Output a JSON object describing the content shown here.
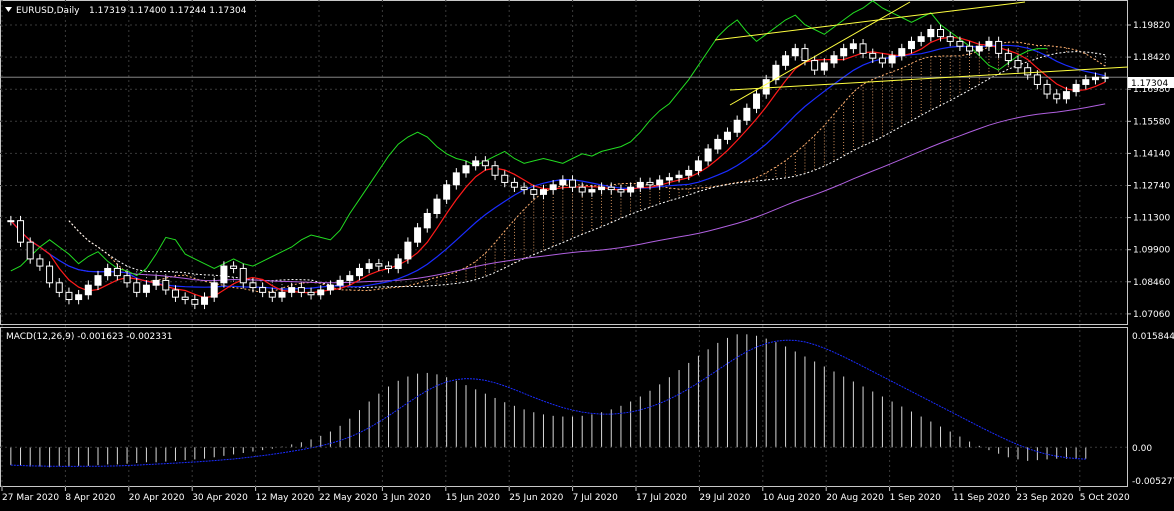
{
  "header": {
    "symbol": "EURUSD,Daily",
    "ohlc": "1.17319 1.17400 1.17244 1.17304",
    "arrow_icon": "triangle-down-icon"
  },
  "macd": {
    "label": "MACD(12,26,9) -0.001623 -0.002331",
    "scale_top": "0.015844",
    "scale_zero": "0.00",
    "scale_bottom": "-0.005277"
  },
  "price_axis": {
    "labels": [
      "1.19820",
      "1.18420",
      "1.16980",
      "1.15580",
      "1.14140",
      "1.12740",
      "1.11300",
      "1.09900",
      "1.08460",
      "1.07060"
    ],
    "current_price": "1.17304"
  },
  "time_axis": {
    "labels": [
      "27 Mar 2020",
      "8 Apr 2020",
      "20 Apr 2020",
      "30 Apr 2020",
      "12 May 2020",
      "22 May 2020",
      "3 Jun 2020",
      "15 Jun 2020",
      "25 Jun 2020",
      "7 Jul 2020",
      "17 Jul 2020",
      "29 Jul 2020",
      "10 Aug 2020",
      "20 Aug 2020",
      "1 Sep 2020",
      "11 Sep 2020",
      "23 Sep 2020",
      "5 Oct 2020"
    ]
  },
  "colors": {
    "background": "#000000",
    "grid": "#3a3a3a",
    "candle": "#ffffff",
    "tenkan": "#ff1a1a",
    "kijun": "#1a2cff",
    "chikou": "#22dd22",
    "senkou_a": "#ffb070",
    "senkou_b": "#ffffff",
    "sma": "#b060e0",
    "trendline": "#ffff40",
    "macd_hist": "#d8d8d8",
    "macd_signal": "#1a2cff"
  },
  "chart_data": {
    "type": "candlestick",
    "symbol": "EURUSD",
    "timeframe": "Daily",
    "ylim": [
      1.0706,
      1.2045
    ],
    "close_series": [
      1.113,
      1.104,
      1.097,
      1.094,
      1.087,
      1.083,
      1.08,
      1.082,
      1.086,
      1.09,
      1.093,
      1.09,
      1.087,
      1.083,
      1.086,
      1.088,
      1.084,
      1.081,
      1.08,
      1.078,
      1.081,
      1.087,
      1.094,
      1.093,
      1.087,
      1.085,
      1.083,
      1.081,
      1.083,
      1.085,
      1.083,
      1.082,
      1.084,
      1.086,
      1.088,
      1.09,
      1.093,
      1.095,
      1.094,
      1.093,
      1.097,
      1.104,
      1.11,
      1.116,
      1.122,
      1.128,
      1.133,
      1.136,
      1.138,
      1.136,
      1.132,
      1.129,
      1.127,
      1.126,
      1.124,
      1.126,
      1.128,
      1.13,
      1.127,
      1.125,
      1.126,
      1.127,
      1.126,
      1.125,
      1.127,
      1.129,
      1.128,
      1.13,
      1.131,
      1.132,
      1.134,
      1.138,
      1.143,
      1.147,
      1.15,
      1.155,
      1.16,
      1.166,
      1.172,
      1.178,
      1.182,
      1.185,
      1.18,
      1.176,
      1.179,
      1.182,
      1.185,
      1.187,
      1.183,
      1.181,
      1.179,
      1.182,
      1.185,
      1.188,
      1.19,
      1.193,
      1.19,
      1.188,
      1.186,
      1.184,
      1.186,
      1.188,
      1.183,
      1.18,
      1.177,
      1.174,
      1.17,
      1.166,
      1.164,
      1.167,
      1.17,
      1.172,
      1.173,
      1.173
    ],
    "macd_hist": [
      -0.0025,
      -0.0026,
      -0.0027,
      -0.0027,
      -0.0028,
      -0.0027,
      -0.0027,
      -0.0026,
      -0.0026,
      -0.0025,
      -0.0024,
      -0.0024,
      -0.0023,
      -0.0022,
      -0.0021,
      -0.0021,
      -0.002,
      -0.0019,
      -0.0018,
      -0.0017,
      -0.0016,
      -0.0014,
      -0.0012,
      -0.001,
      -0.0008,
      -0.0006,
      -0.0004,
      -0.0002,
      0.0001,
      0.0004,
      0.0007,
      0.0011,
      0.0016,
      0.0022,
      0.003,
      0.004,
      0.0052,
      0.0064,
      0.0075,
      0.0085,
      0.0093,
      0.0099,
      0.0103,
      0.0104,
      0.0102,
      0.0098,
      0.0093,
      0.0087,
      0.0081,
      0.0075,
      0.0069,
      0.0063,
      0.0058,
      0.0053,
      0.0049,
      0.0046,
      0.0044,
      0.0043,
      0.0043,
      0.0044,
      0.0046,
      0.0049,
      0.0053,
      0.0058,
      0.0064,
      0.0071,
      0.0079,
      0.0088,
      0.0098,
      0.0108,
      0.0118,
      0.0128,
      0.0137,
      0.0146,
      0.0153,
      0.0158,
      0.0158,
      0.0156,
      0.0152,
      0.0147,
      0.0141,
      0.0134,
      0.0127,
      0.012,
      0.0113,
      0.0106,
      0.0099,
      0.0092,
      0.0085,
      0.0078,
      0.0071,
      0.0064,
      0.0057,
      0.005,
      0.0043,
      0.0036,
      0.0029,
      0.0022,
      0.0015,
      0.0008,
      0.0002,
      -0.0004,
      -0.0009,
      -0.0014,
      -0.0017,
      -0.0019,
      -0.0018,
      -0.0017,
      -0.0016,
      -0.0016,
      -0.0016,
      -0.0016
    ],
    "macd_ylim": [
      -0.005277,
      0.015844
    ]
  }
}
